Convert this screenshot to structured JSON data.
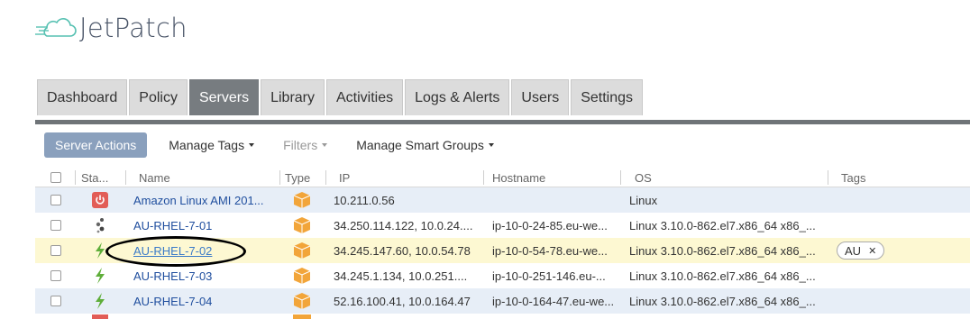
{
  "brand": {
    "name": "JetPatch",
    "accent": "#57c1b2"
  },
  "nav": {
    "tabs": [
      {
        "label": "Dashboard",
        "active": false
      },
      {
        "label": "Policy",
        "active": false
      },
      {
        "label": "Servers",
        "active": true
      },
      {
        "label": "Library",
        "active": false
      },
      {
        "label": "Activities",
        "active": false
      },
      {
        "label": "Logs & Alerts",
        "active": false
      },
      {
        "label": "Users",
        "active": false
      },
      {
        "label": "Settings",
        "active": false
      }
    ]
  },
  "toolbar": {
    "server_actions": "Server Actions",
    "manage_tags": "Manage Tags",
    "filters": "Filters",
    "manage_smart_groups": "Manage Smart Groups"
  },
  "table": {
    "columns": {
      "status": "Sta...",
      "name": "Name",
      "type": "Type",
      "ip": "IP",
      "hostname": "Hostname",
      "os": "OS",
      "tags": "Tags"
    },
    "rows": [
      {
        "status_icon": "power-off-icon",
        "name": "Amazon Linux AMI 201...",
        "type_icon": "package-box-icon",
        "ip": "10.211.0.56",
        "hostname": "",
        "os": "Linux",
        "tag": ""
      },
      {
        "status_icon": "connecting-icon",
        "name": "AU-RHEL-7-01",
        "type_icon": "package-box-icon",
        "ip": "34.250.114.122, 10.0.24....",
        "hostname": "ip-10-0-24-85.eu-we...",
        "os": "Linux 3.10.0-862.el7.x86_64 x86_...",
        "tag": ""
      },
      {
        "status_icon": "lightning-icon",
        "name": "AU-RHEL-7-02",
        "type_icon": "package-box-icon",
        "ip": "34.245.147.60, 10.0.54.78",
        "hostname": "ip-10-0-54-78.eu-we...",
        "os": "Linux 3.10.0-862.el7.x86_64 x86_...",
        "tag": "AU"
      },
      {
        "status_icon": "lightning-icon",
        "name": "AU-RHEL-7-03",
        "type_icon": "package-box-icon",
        "ip": "34.245.1.134, 10.0.251....",
        "hostname": "ip-10-0-251-146.eu-...",
        "os": "Linux 3.10.0-862.el7.x86_64 x86_...",
        "tag": ""
      },
      {
        "status_icon": "lightning-icon",
        "name": "AU-RHEL-7-04",
        "type_icon": "package-box-icon",
        "ip": "52.16.100.41, 10.0.164.47",
        "hostname": "ip-10-0-164-47.eu-we...",
        "os": "Linux 3.10.0-862.el7.x86_64 x86_...",
        "tag": ""
      }
    ]
  }
}
